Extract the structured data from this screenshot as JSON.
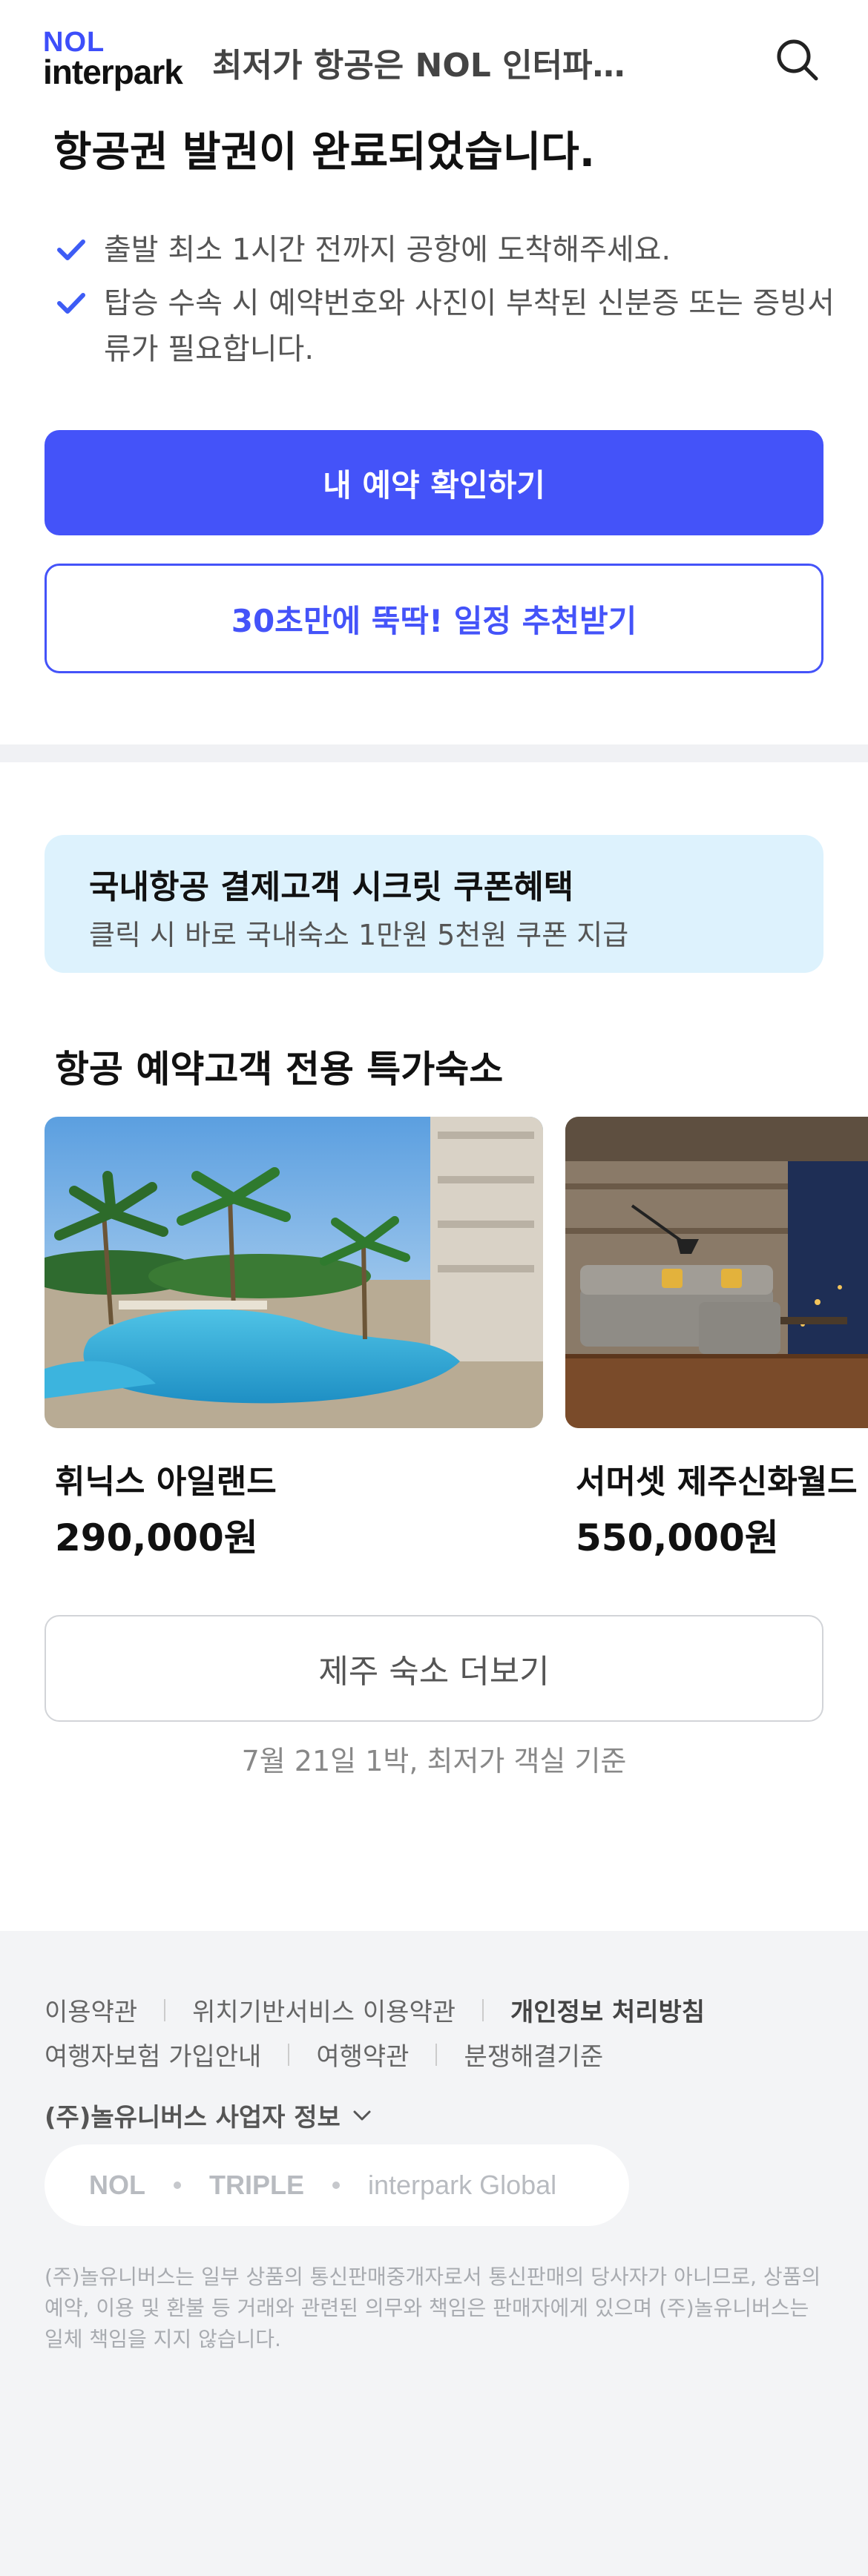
{
  "header": {
    "logo_top": "NOL",
    "logo_bottom": "interpark",
    "title": "최저가 항공은 NOL 인터파…"
  },
  "completion": {
    "title": "항공권 발권이 완료되었습니다.",
    "notices": [
      "출발 최소 1시간 전까지 공항에 도착해주세요.",
      "탑승 수속 시 예약번호와 사진이 부착된 신분증 또는 증빙서류가 필요합니다."
    ],
    "primary_button": "내 예약 확인하기",
    "secondary_button": "30초만에 뚝딱! 일정 추천받기"
  },
  "coupon": {
    "title": "국내항공 결제고객 시크릿 쿠폰혜택",
    "subtitle": "클릭 시 바로 국내숙소 1만원 5천원 쿠폰 지급"
  },
  "hotels": {
    "section_title": "항공 예약고객 전용 특가숙소",
    "items": [
      {
        "name": "휘닉스 아일랜드",
        "price": "290,000원"
      },
      {
        "name": "서머셋 제주신화월드",
        "price": "550,000원"
      }
    ],
    "more_button": "제주 숙소 더보기",
    "note": "7월 21일 1박, 최저가 객실 기준"
  },
  "footer": {
    "links_row1": [
      "이용약관",
      "위치기반서비스 이용약관",
      "개인정보 처리방침"
    ],
    "links_row2": [
      "여행자보험 가입안내",
      "여행약관",
      "분쟁해결기준"
    ],
    "business_info": "(주)놀유니버스 사업자 정보",
    "brands": [
      "NOL",
      "TRIPLE",
      "interpark Global"
    ],
    "disclaimer": "(주)놀유니버스는 일부 상품의 통신판매중개자로서 통신판매의 당사자가 아니므로, 상품의 예약, 이용 및 환불 등 거래와 관련된 의무와 책임은 판매자에게 있으며 (주)놀유니버스는 일체 책임을 지지 않습니다."
  },
  "colors": {
    "accent": "#4453f9",
    "coupon_bg": "#ddf2fd",
    "footer_bg": "#f3f4f6"
  },
  "icons": {
    "search": "search-icon",
    "check": "check-icon",
    "chevron": "chevron-down-icon"
  }
}
